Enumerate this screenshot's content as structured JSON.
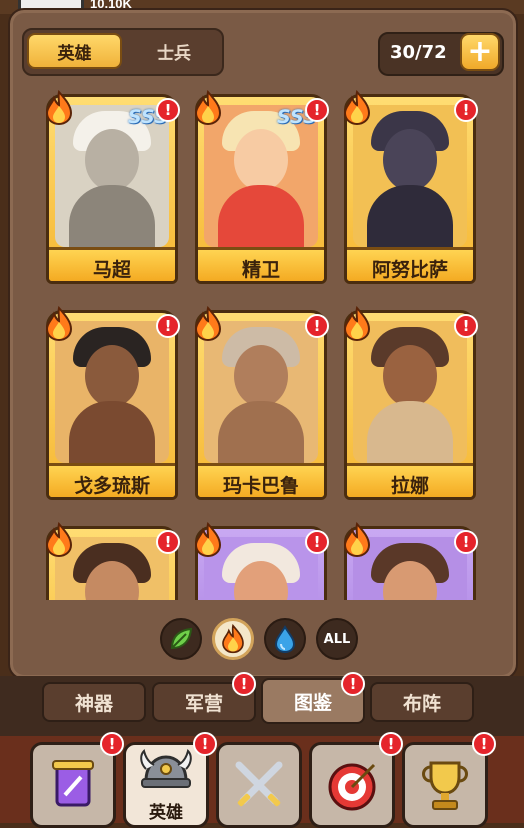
{
  "top": {
    "label": "10,10K"
  },
  "segment": {
    "heroes": "英雄",
    "soldiers": "士兵"
  },
  "collection": {
    "count": "30/72",
    "add": "+"
  },
  "cards": [
    {
      "name": "马超",
      "rank": "SSS",
      "alert": "!"
    },
    {
      "name": "精卫",
      "rank": "SSS",
      "alert": "!"
    },
    {
      "name": "阿努比萨",
      "rank": "",
      "alert": "!"
    },
    {
      "name": "戈多琉斯",
      "rank": "",
      "alert": "!"
    },
    {
      "name": "玛卡巴鲁",
      "rank": "",
      "alert": "!"
    },
    {
      "name": "拉娜",
      "rank": "",
      "alert": "!"
    },
    {
      "name": "",
      "rank": "",
      "alert": "!"
    },
    {
      "name": "",
      "rank": "",
      "alert": "!"
    },
    {
      "name": "",
      "rank": "",
      "alert": "!"
    }
  ],
  "filters": {
    "all": "ALL"
  },
  "tabs": [
    {
      "label": "神器"
    },
    {
      "label": "军营"
    },
    {
      "label": "图鉴"
    },
    {
      "label": "布阵"
    }
  ],
  "bottom_nav": {
    "heroes_label": "英雄"
  },
  "alert": "!"
}
